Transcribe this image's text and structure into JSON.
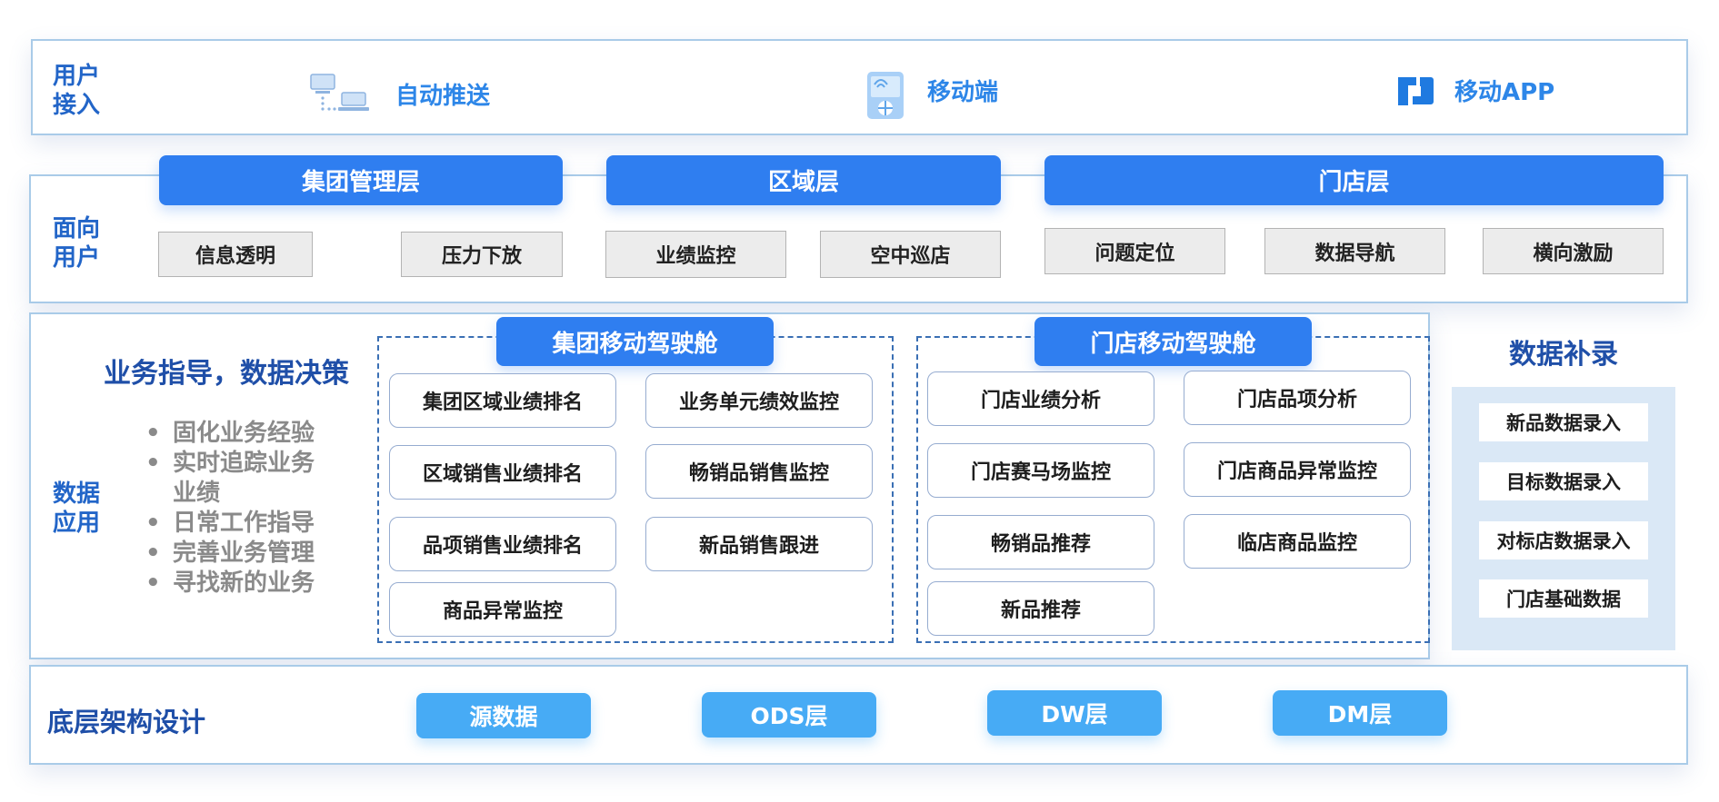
{
  "access": {
    "label": "用户\n接入",
    "items": [
      {
        "icon": "network-computers-icon",
        "text": "自动推送"
      },
      {
        "icon": "mobile-device-icon",
        "text": "移动端"
      },
      {
        "icon": "app-logo-icon",
        "text": "移动APP"
      }
    ]
  },
  "user_facing": {
    "label": "面向\n用户",
    "groups": [
      {
        "title": "集团管理层",
        "items": [
          "信息透明",
          "压力下放"
        ]
      },
      {
        "title": "区域层",
        "items": [
          "业绩监控",
          "空中巡店"
        ]
      },
      {
        "title": "门店层",
        "items": [
          "问题定位",
          "数据导航",
          "横向激励"
        ]
      }
    ]
  },
  "data_app": {
    "label": "数据\n应用",
    "title": "业务指导，数据决策",
    "bullets": [
      "固化业务经验",
      "实时追踪业务\n业绩",
      "日常工作指导",
      "完善业务管理",
      "寻找新的业务"
    ],
    "cockpits": [
      {
        "title": "集团移动驾驶舱",
        "items": [
          "集团区域业绩排名",
          "业务单元绩效监控",
          "区域销售业绩排名",
          "畅销品销售监控",
          "品项销售业绩排名",
          "新品销售跟进",
          "商品异常监控"
        ]
      },
      {
        "title": "门店移动驾驶舱",
        "items": [
          "门店业绩分析",
          "门店品项分析",
          "门店赛马场监控",
          "门店商品异常监控",
          "畅销品推荐",
          "临店商品监控",
          "新品推荐"
        ]
      }
    ]
  },
  "supplement": {
    "title": "数据补录",
    "items": [
      "新品数据录入",
      "目标数据录入",
      "对标店数据录入",
      "门店基础数据"
    ]
  },
  "infrastructure": {
    "label": "底层架构设计",
    "items": [
      "源数据",
      "ODS层",
      "DW层",
      "DM层"
    ]
  },
  "colors": {
    "primary_blue": "#2f7ef0",
    "light_blue": "#47abf5",
    "dark_navy": "#1f4fa8",
    "border": "#a9cbe8",
    "gray_box": "#ececec"
  }
}
